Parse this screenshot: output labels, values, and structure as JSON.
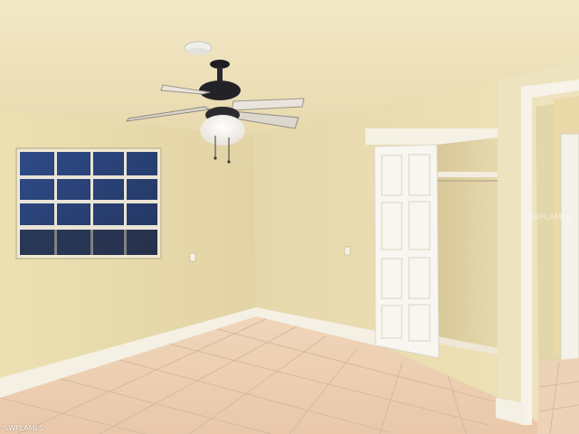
{
  "watermark": {
    "corner": "SWFLAMLS",
    "center": "SWFLAMLS"
  }
}
